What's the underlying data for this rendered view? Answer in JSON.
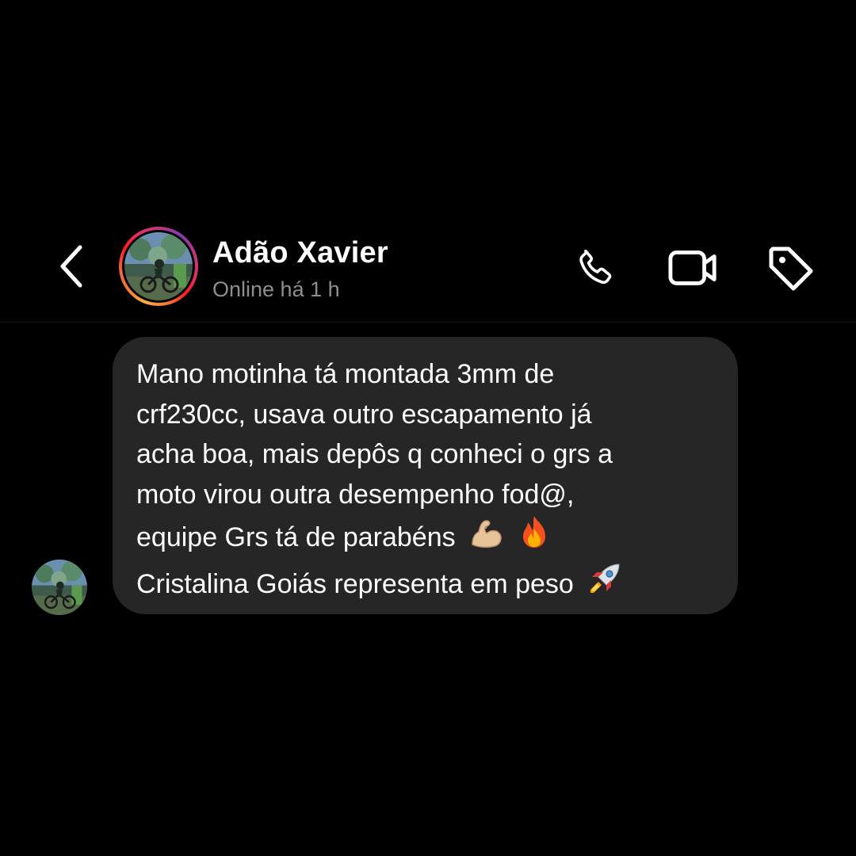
{
  "header": {
    "contact_name": "Adão Xavier",
    "status": "Online há 1 h",
    "icons": {
      "back": "chevron-left-icon",
      "phone": "phone-icon",
      "video": "video-camera-icon",
      "tag": "tag-icon"
    },
    "story_ring_colors": [
      "#fcaf45",
      "#f77737",
      "#fd1d1d",
      "#e1306c",
      "#c13584",
      "#833ab4"
    ]
  },
  "message": {
    "lines": [
      "Mano motinha tá montada 3mm de",
      "crf230cc, usava outro escapamento já",
      "acha boa, mais depôs q conheci o grs a",
      "moto virou outra desempenho fod@,",
      "equipe Grs tá de parabéns",
      "Cristalina Goiás representa em peso"
    ],
    "emojis": {
      "line5": [
        "flexed-biceps-emoji",
        "fire-emoji"
      ],
      "line6": [
        "rocket-emoji"
      ]
    },
    "bubble_color": "#262626"
  }
}
